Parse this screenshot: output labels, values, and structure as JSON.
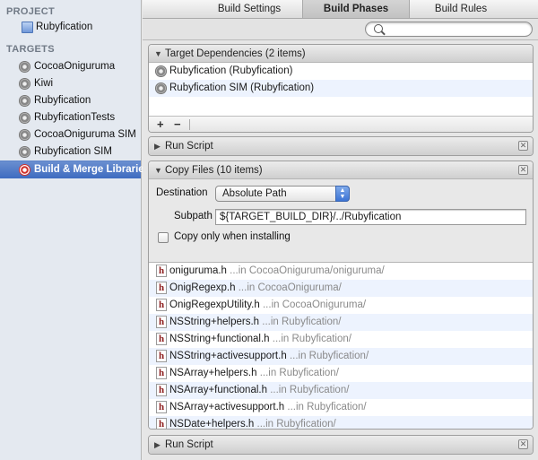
{
  "sidebar": {
    "project_header": "PROJECT",
    "project_name": "Rubyfication",
    "targets_header": "TARGETS",
    "targets": [
      {
        "label": "CocoaOniguruma",
        "icon": "gear-icon"
      },
      {
        "label": "Kiwi",
        "icon": "gear-icon"
      },
      {
        "label": "Rubyfication",
        "icon": "gear-icon"
      },
      {
        "label": "RubyficationTests",
        "icon": "gear-icon"
      },
      {
        "label": "CocoaOniguruma SIM",
        "icon": "gear-icon"
      },
      {
        "label": "Rubyfication SIM",
        "icon": "gear-icon"
      },
      {
        "label": "Build & Merge Libraries",
        "icon": "target-icon",
        "selected": true
      }
    ]
  },
  "tabs": [
    "Build Settings",
    "Build Phases",
    "Build Rules"
  ],
  "search": {
    "placeholder": "",
    "value": ""
  },
  "phases": {
    "target_dependencies": {
      "title": "Target Dependencies (2 items)",
      "items": [
        "Rubyfication (Rubyfication)",
        "Rubyfication SIM (Rubyfication)"
      ]
    },
    "run_script_1": {
      "title": "Run Script"
    },
    "copy_files": {
      "title": "Copy Files (10 items)",
      "destination_label": "Destination",
      "destination_value": "Absolute Path",
      "subpath_label": "Subpath",
      "subpath_value": "${TARGET_BUILD_DIR}/../Rubyfication",
      "copy_only_label": "Copy only when installing",
      "files": [
        {
          "name": "oniguruma.h",
          "loc": "...in CocoaOniguruma/oniguruma/"
        },
        {
          "name": "OnigRegexp.h",
          "loc": "...in CocoaOniguruma/"
        },
        {
          "name": "OnigRegexpUtility.h",
          "loc": "...in CocoaOniguruma/"
        },
        {
          "name": "NSString+helpers.h",
          "loc": "...in Rubyfication/"
        },
        {
          "name": "NSString+functional.h",
          "loc": "...in Rubyfication/"
        },
        {
          "name": "NSString+activesupport.h",
          "loc": "...in Rubyfication/"
        },
        {
          "name": "NSArray+helpers.h",
          "loc": "...in Rubyfication/"
        },
        {
          "name": "NSArray+functional.h",
          "loc": "...in Rubyfication/"
        },
        {
          "name": "NSArray+activesupport.h",
          "loc": "...in Rubyfication/"
        },
        {
          "name": "NSDate+helpers.h",
          "loc": "...in Rubyfication/"
        }
      ]
    },
    "run_script_2": {
      "title": "Run Script"
    }
  },
  "footer": {
    "add": "+",
    "remove": "−"
  }
}
